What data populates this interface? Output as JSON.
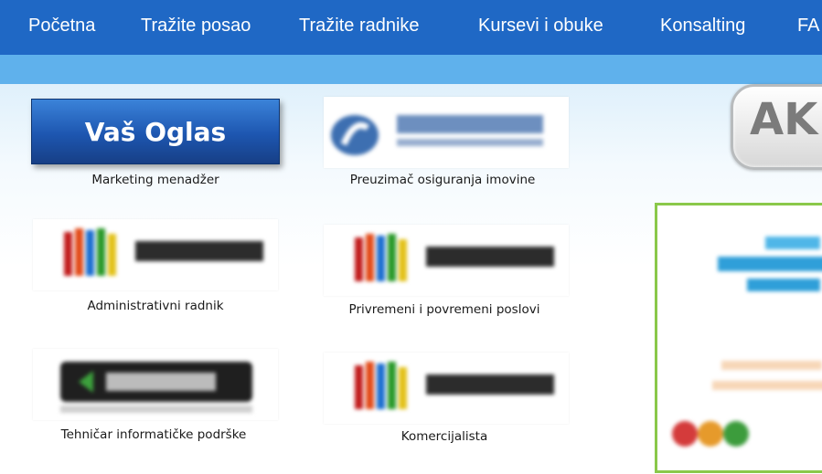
{
  "nav": {
    "items": [
      {
        "label": "Početna"
      },
      {
        "label": "Tražite posao"
      },
      {
        "label": "Tražite radnike"
      },
      {
        "label": "Kursevi i obuke"
      },
      {
        "label": "Konsalting"
      },
      {
        "label": "FA"
      }
    ]
  },
  "featured": {
    "button_label": "Vaš Oglas"
  },
  "jobs": [
    {
      "caption": "Marketing menadžer",
      "logo": "vas-oglas"
    },
    {
      "caption": "Preuzimač osiguranja imovine",
      "logo": "brcko-gas"
    },
    {
      "caption": "Administrativni radnik",
      "logo": "spektar"
    },
    {
      "caption": "Privremeni i povremeni poslovi",
      "logo": "spektar"
    },
    {
      "caption": "Tehničar informatičke podrške",
      "logo": "zoot"
    },
    {
      "caption": "Komercijalista",
      "logo": "spektar"
    }
  ],
  "aktuelno_badge": {
    "label": "AK"
  },
  "colors": {
    "nav_bg": "#1f68c5",
    "band_bg": "#5fb1ec",
    "promo_border": "#8ac84a"
  }
}
